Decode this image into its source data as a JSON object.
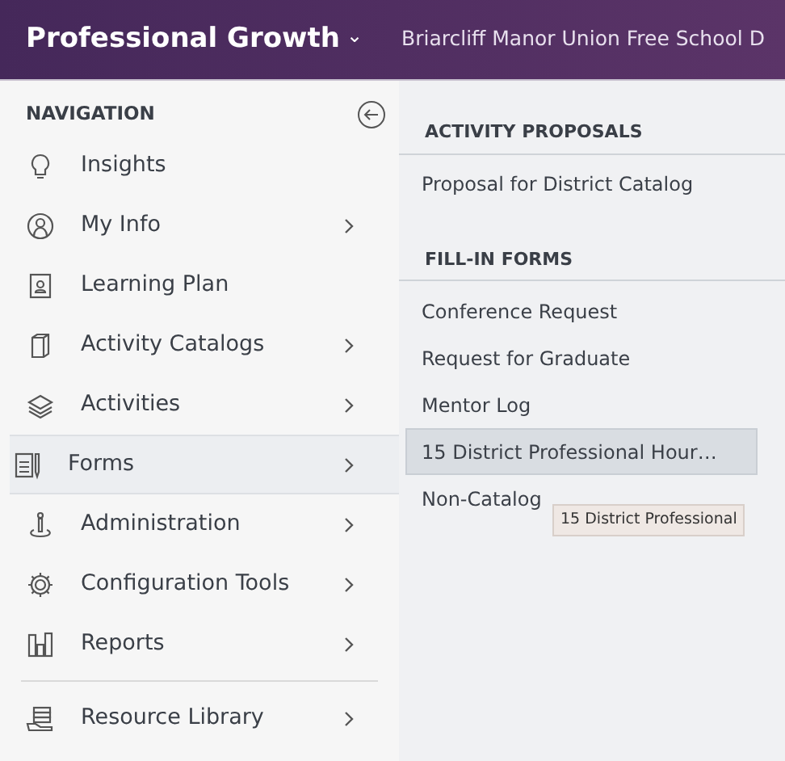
{
  "header": {
    "app_title": "Professional Growth",
    "dropdown_caret": "⌄",
    "district": "Briarcliff Manor Union Free School D"
  },
  "navigation": {
    "title": "NAVIGATION",
    "items": [
      {
        "label": "Insights",
        "submenu": false,
        "selected": false,
        "separated": false
      },
      {
        "label": "My Info",
        "submenu": true,
        "selected": false,
        "separated": false
      },
      {
        "label": "Learning Plan",
        "submenu": false,
        "selected": false,
        "separated": false
      },
      {
        "label": "Activity Catalogs",
        "submenu": true,
        "selected": false,
        "separated": false
      },
      {
        "label": "Activities",
        "submenu": true,
        "selected": false,
        "separated": false
      },
      {
        "label": "Forms",
        "submenu": true,
        "selected": true,
        "separated": false
      },
      {
        "label": "Administration",
        "submenu": true,
        "selected": false,
        "separated": false
      },
      {
        "label": "Configuration Tools",
        "submenu": true,
        "selected": false,
        "separated": false
      },
      {
        "label": "Reports",
        "submenu": true,
        "selected": false,
        "separated": false
      },
      {
        "label": "Resource Library",
        "submenu": true,
        "selected": false,
        "separated": true
      }
    ]
  },
  "sections": [
    {
      "title": "ACTIVITY PROPOSALS",
      "items": [
        {
          "label": "Proposal for District Catalog",
          "selected": false
        }
      ]
    },
    {
      "title": "FILL-IN FORMS",
      "items": [
        {
          "label": "Conference Request",
          "selected": false
        },
        {
          "label": "Request for Graduate",
          "selected": false
        },
        {
          "label": "Mentor Log",
          "selected": false
        },
        {
          "label": "15 District Professional Hour…",
          "selected": true
        },
        {
          "label": "Non-Catalog",
          "selected": false
        }
      ]
    }
  ],
  "tooltip": {
    "text": "15 District Professional"
  }
}
